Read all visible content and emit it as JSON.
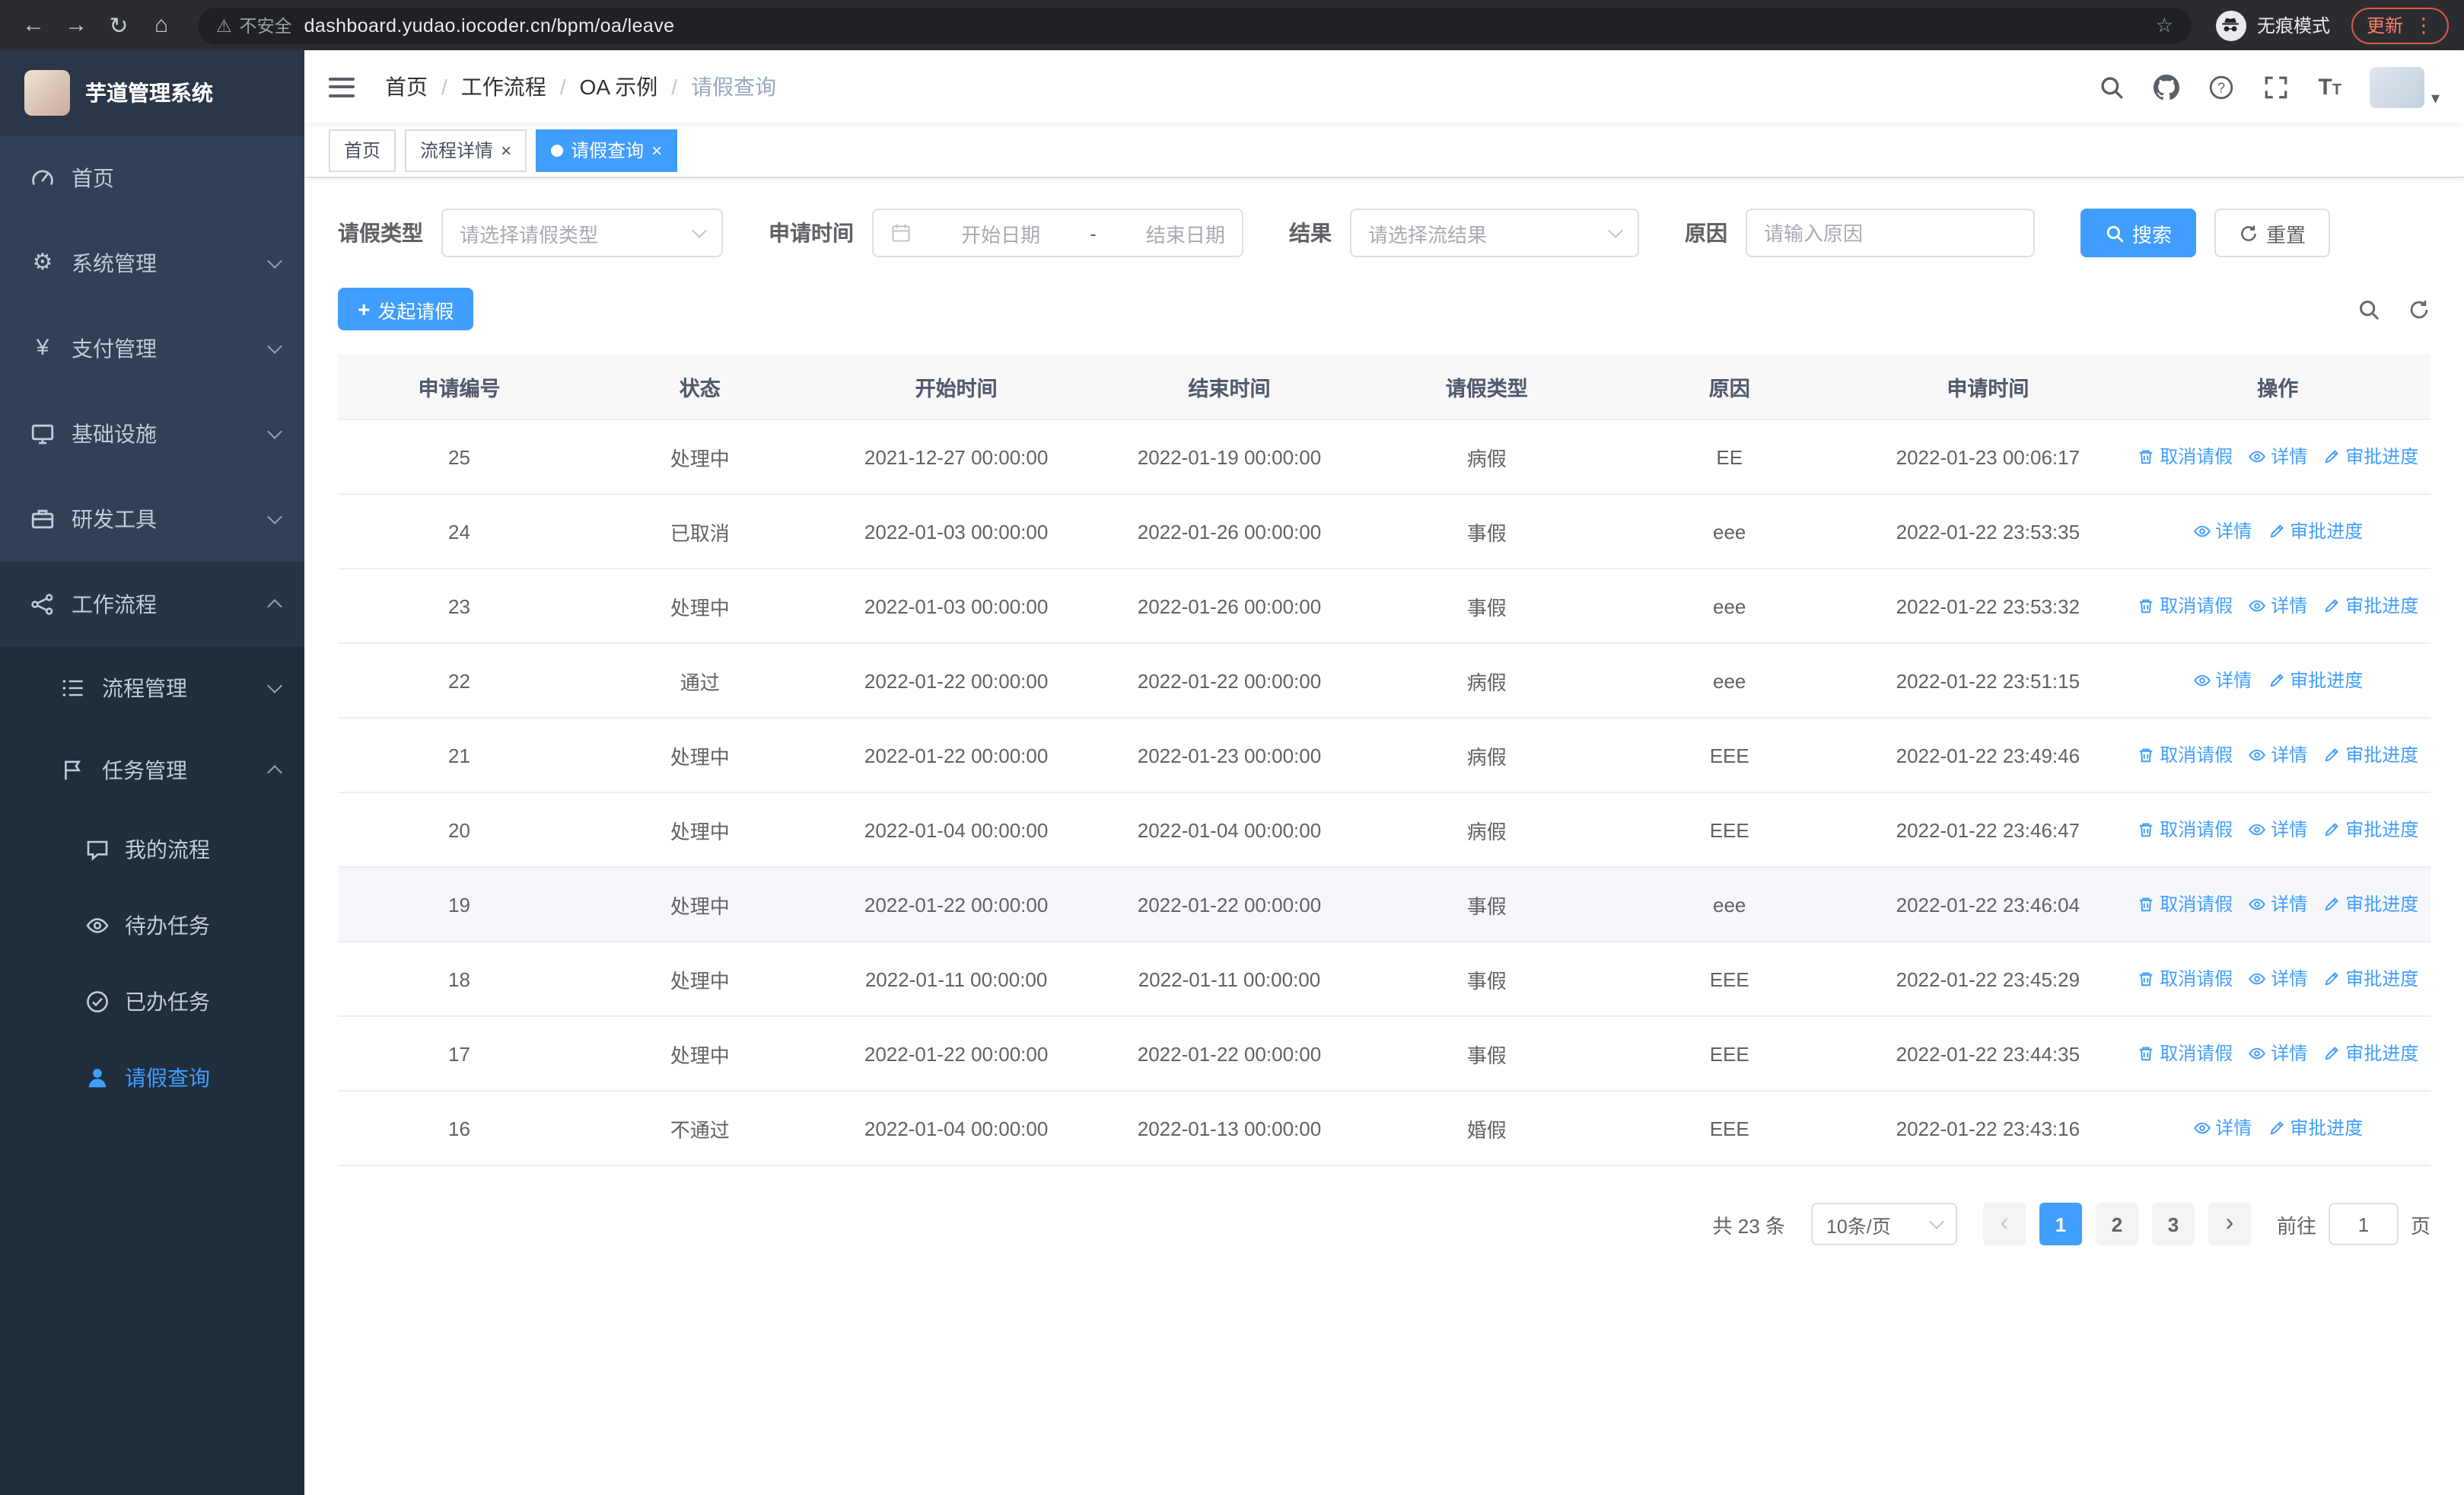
{
  "icons": {
    "back": "←",
    "forward": "→",
    "reload": "↻",
    "home": "⌂",
    "warning": "⚠",
    "star": "☆",
    "kebab": "⋮",
    "gear": "⚙",
    "yen": "¥",
    "caret_down": "▾",
    "close": "×",
    "plus": "+",
    "chevron_left": "‹",
    "chevron_right": "›"
  },
  "browser": {
    "security_warning": "不安全",
    "url": "dashboard.yudao.iocoder.cn/bpm/oa/leave",
    "incognito_label": "无痕模式",
    "update_label": "更新"
  },
  "sidebar": {
    "app_title": "芋道管理系统",
    "items": [
      {
        "label": "首页"
      },
      {
        "label": "系统管理"
      },
      {
        "label": "支付管理"
      },
      {
        "label": "基础设施"
      },
      {
        "label": "研发工具"
      },
      {
        "label": "工作流程"
      }
    ],
    "workflow_children": [
      {
        "label": "流程管理"
      },
      {
        "label": "任务管理"
      }
    ],
    "task_children": [
      {
        "label": "我的流程"
      },
      {
        "label": "待办任务"
      },
      {
        "label": "已办任务"
      },
      {
        "label": "请假查询"
      }
    ]
  },
  "header": {
    "separator": "/",
    "breadcrumb": [
      "首页",
      "工作流程",
      "OA 示例",
      "请假查询"
    ]
  },
  "tabs": [
    {
      "label": "首页",
      "closable": false,
      "active": false
    },
    {
      "label": "流程详情",
      "closable": true,
      "active": false
    },
    {
      "label": "请假查询",
      "closable": true,
      "active": true
    }
  ],
  "filters": {
    "leave_type_label": "请假类型",
    "leave_type_placeholder": "请选择请假类型",
    "apply_time_label": "申请时间",
    "date_start_placeholder": "开始日期",
    "date_separator": "-",
    "date_end_placeholder": "结束日期",
    "result_label": "结果",
    "result_placeholder": "请选择流结果",
    "reason_label": "原因",
    "reason_placeholder": "请输入原因",
    "search_button": "搜索",
    "reset_button": "重置"
  },
  "toolbar": {
    "create_button": "发起请假"
  },
  "table": {
    "columns": [
      "申请编号",
      "状态",
      "开始时间",
      "结束时间",
      "请假类型",
      "原因",
      "申请时间",
      "操作"
    ],
    "action_labels": {
      "cancel": "取消请假",
      "detail": "详情",
      "progress": "审批进度"
    },
    "rows": [
      {
        "id": "25",
        "status": "处理中",
        "start": "2021-12-27 00:00:00",
        "end": "2022-01-19 00:00:00",
        "type": "病假",
        "reason": "EE",
        "applied": "2022-01-23 00:06:17",
        "highlighted": false,
        "actions": [
          "cancel",
          "detail",
          "progress"
        ]
      },
      {
        "id": "24",
        "status": "已取消",
        "start": "2022-01-03 00:00:00",
        "end": "2022-01-26 00:00:00",
        "type": "事假",
        "reason": "eee",
        "applied": "2022-01-22 23:53:35",
        "highlighted": false,
        "actions": [
          "detail",
          "progress"
        ]
      },
      {
        "id": "23",
        "status": "处理中",
        "start": "2022-01-03 00:00:00",
        "end": "2022-01-26 00:00:00",
        "type": "事假",
        "reason": "eee",
        "applied": "2022-01-22 23:53:32",
        "highlighted": false,
        "actions": [
          "cancel",
          "detail",
          "progress"
        ]
      },
      {
        "id": "22",
        "status": "通过",
        "start": "2022-01-22 00:00:00",
        "end": "2022-01-22 00:00:00",
        "type": "病假",
        "reason": "eee",
        "applied": "2022-01-22 23:51:15",
        "highlighted": false,
        "actions": [
          "detail",
          "progress"
        ]
      },
      {
        "id": "21",
        "status": "处理中",
        "start": "2022-01-22 00:00:00",
        "end": "2022-01-23 00:00:00",
        "type": "病假",
        "reason": "EEE",
        "applied": "2022-01-22 23:49:46",
        "highlighted": false,
        "actions": [
          "cancel",
          "detail",
          "progress"
        ]
      },
      {
        "id": "20",
        "status": "处理中",
        "start": "2022-01-04 00:00:00",
        "end": "2022-01-04 00:00:00",
        "type": "病假",
        "reason": "EEE",
        "applied": "2022-01-22 23:46:47",
        "highlighted": false,
        "actions": [
          "cancel",
          "detail",
          "progress"
        ]
      },
      {
        "id": "19",
        "status": "处理中",
        "start": "2022-01-22 00:00:00",
        "end": "2022-01-22 00:00:00",
        "type": "事假",
        "reason": "eee",
        "applied": "2022-01-22 23:46:04",
        "highlighted": true,
        "actions": [
          "cancel",
          "detail",
          "progress"
        ]
      },
      {
        "id": "18",
        "status": "处理中",
        "start": "2022-01-11 00:00:00",
        "end": "2022-01-11 00:00:00",
        "type": "事假",
        "reason": "EEE",
        "applied": "2022-01-22 23:45:29",
        "highlighted": false,
        "actions": [
          "cancel",
          "detail",
          "progress"
        ]
      },
      {
        "id": "17",
        "status": "处理中",
        "start": "2022-01-22 00:00:00",
        "end": "2022-01-22 00:00:00",
        "type": "事假",
        "reason": "EEE",
        "applied": "2022-01-22 23:44:35",
        "highlighted": false,
        "actions": [
          "cancel",
          "detail",
          "progress"
        ]
      },
      {
        "id": "16",
        "status": "不通过",
        "start": "2022-01-04 00:00:00",
        "end": "2022-01-13 00:00:00",
        "type": "婚假",
        "reason": "EEE",
        "applied": "2022-01-22 23:43:16",
        "highlighted": false,
        "actions": [
          "detail",
          "progress"
        ]
      }
    ]
  },
  "pagination": {
    "total_text": "共 23 条",
    "page_size": "10条/页",
    "pages": [
      "1",
      "2",
      "3"
    ],
    "active_page": "1",
    "goto_prefix": "前往",
    "goto_value": "1",
    "goto_suffix": "页"
  }
}
